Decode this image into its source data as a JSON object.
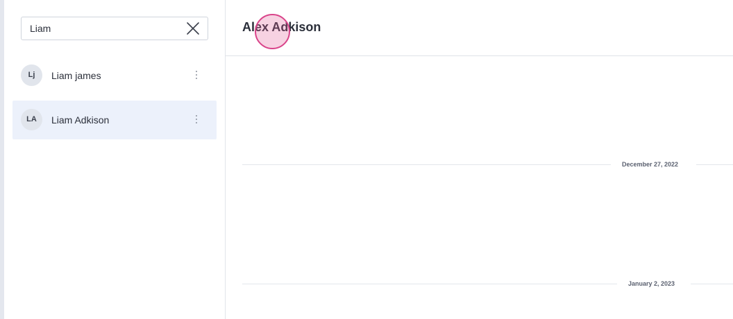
{
  "search": {
    "value": "Liam",
    "placeholder": ""
  },
  "contacts": [
    {
      "initials": "Lj",
      "name": "Liam james",
      "selected": false
    },
    {
      "initials": "LA",
      "name": "Liam Adkison",
      "selected": true
    }
  ],
  "conversation": {
    "title": "Alex Adkison",
    "dates": [
      "December 27, 2022",
      "January 2, 2023"
    ]
  },
  "icons": {
    "clear": "close-icon",
    "more": "more-vertical-icon"
  },
  "colors": {
    "selected_row": "#ecf1fb",
    "cursor_highlight": "#d9448a"
  }
}
